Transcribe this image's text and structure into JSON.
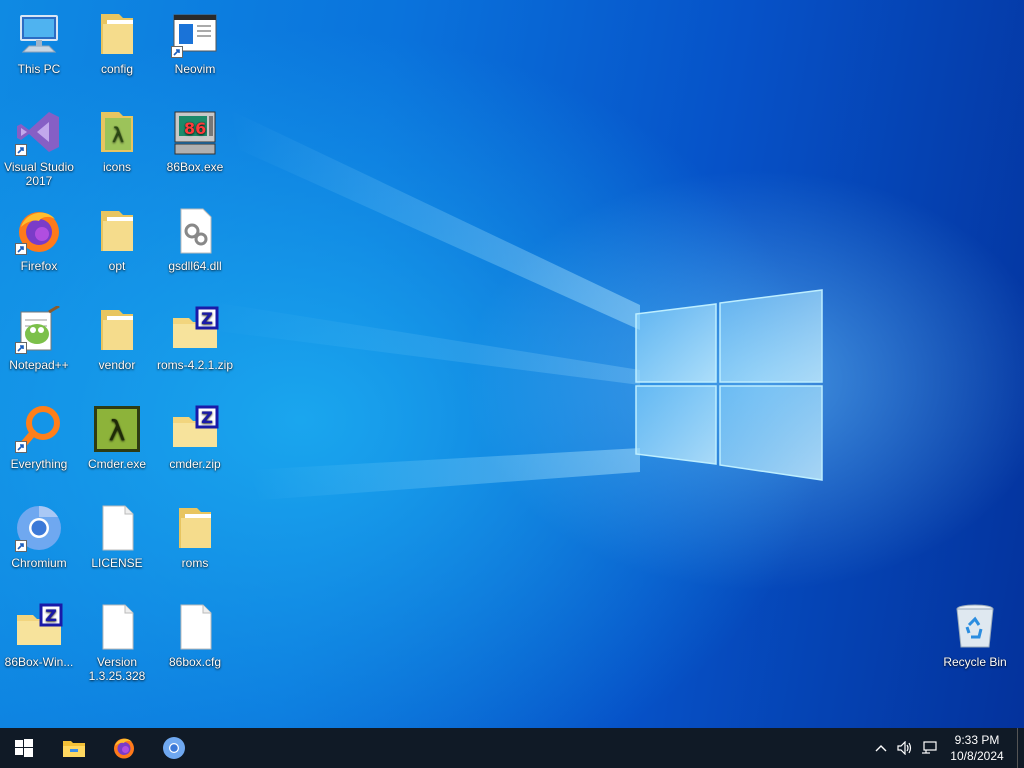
{
  "desktop": {
    "icons": [
      {
        "id": "this-pc",
        "label": "This PC",
        "kind": "computer",
        "shortcut": false
      },
      {
        "id": "config",
        "label": "config",
        "kind": "folder",
        "shortcut": false
      },
      {
        "id": "neovim",
        "label": "Neovim",
        "kind": "app-window",
        "shortcut": true
      },
      {
        "id": "visual-studio",
        "label": "Visual Studio 2017",
        "kind": "vs",
        "shortcut": true
      },
      {
        "id": "icons",
        "label": "icons",
        "kind": "folder-lambda",
        "shortcut": false
      },
      {
        "id": "86box-exe",
        "label": "86Box.exe",
        "kind": "86box",
        "shortcut": false
      },
      {
        "id": "firefox",
        "label": "Firefox",
        "kind": "firefox",
        "shortcut": true
      },
      {
        "id": "opt",
        "label": "opt",
        "kind": "folder",
        "shortcut": false
      },
      {
        "id": "gsdll64",
        "label": "gsdll64.dll",
        "kind": "dll",
        "shortcut": false
      },
      {
        "id": "notepadpp",
        "label": "Notepad++",
        "kind": "notepadpp",
        "shortcut": true
      },
      {
        "id": "vendor",
        "label": "vendor",
        "kind": "folder",
        "shortcut": false
      },
      {
        "id": "roms-zip",
        "label": "roms-4.2.1.zip",
        "kind": "zip",
        "shortcut": false
      },
      {
        "id": "everything",
        "label": "Everything",
        "kind": "everything",
        "shortcut": true
      },
      {
        "id": "cmder-exe",
        "label": "Cmder.exe",
        "kind": "cmder",
        "shortcut": false
      },
      {
        "id": "cmder-zip",
        "label": "cmder.zip",
        "kind": "zip",
        "shortcut": false
      },
      {
        "id": "chromium",
        "label": "Chromium",
        "kind": "chromium",
        "shortcut": true
      },
      {
        "id": "license",
        "label": "LICENSE",
        "kind": "file",
        "shortcut": false
      },
      {
        "id": "roms",
        "label": "roms",
        "kind": "folder",
        "shortcut": false
      },
      {
        "id": "86box-win",
        "label": "86Box-Win...",
        "kind": "zip",
        "shortcut": false
      },
      {
        "id": "version",
        "label": "Version 1.3.25.328",
        "kind": "file",
        "shortcut": false
      },
      {
        "id": "86box-cfg",
        "label": "86box.cfg",
        "kind": "file",
        "shortcut": false
      },
      {
        "id": "recycle-bin",
        "label": "Recycle Bin",
        "kind": "recycle",
        "shortcut": false
      }
    ]
  },
  "taskbar": {
    "pinned": [
      {
        "id": "start",
        "icon": "windows-start-icon"
      },
      {
        "id": "file-explorer",
        "icon": "file-explorer-icon"
      },
      {
        "id": "firefox",
        "icon": "firefox-icon"
      },
      {
        "id": "chromium",
        "icon": "chromium-icon"
      }
    ],
    "tray": {
      "icons": [
        "chevron-up-icon",
        "volume-icon",
        "network-icon"
      ],
      "time": "9:33 PM",
      "date": "10/8/2024"
    }
  },
  "colors": {
    "taskbar": "#101a26",
    "wallpaper_accent": "#0a73dc",
    "folder": "#f2d57e"
  }
}
